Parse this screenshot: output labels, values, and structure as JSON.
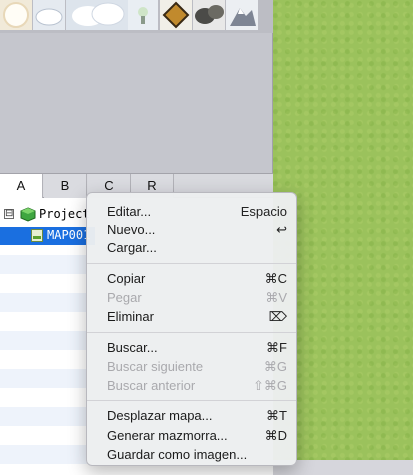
{
  "tabs": [
    {
      "label": "A",
      "active": true
    },
    {
      "label": "B",
      "active": false
    },
    {
      "label": "C",
      "active": false
    },
    {
      "label": "R",
      "active": false
    }
  ],
  "tileset": [
    {
      "icon": "cloud-glow-tile-icon"
    },
    {
      "icon": "snow-mound-tile-icon"
    },
    {
      "icon": "cloud-large-tile-icon"
    },
    {
      "icon": "cloud-puff-tile-icon"
    },
    {
      "icon": "small-tree-tile-icon"
    },
    {
      "icon": "golden-ornament-tile-icon"
    },
    {
      "icon": "dark-rocks-tile-icon"
    },
    {
      "icon": "snowy-rock-tile-icon"
    }
  ],
  "tree": {
    "project_label": "Project",
    "expander": "⊟",
    "map_label": "MAP001"
  },
  "menu": {
    "groups": [
      {
        "items": [
          {
            "label": "Editar...",
            "shortcut": "Espacio",
            "enabled": true
          },
          {
            "label": "Nuevo...",
            "shortcut": "↩",
            "enabled": true
          },
          {
            "label": "Cargar...",
            "shortcut": "",
            "enabled": true
          }
        ]
      },
      {
        "items": [
          {
            "label": "Copiar",
            "shortcut": "⌘C",
            "enabled": true
          },
          {
            "label": "Pegar",
            "shortcut": "⌘V",
            "enabled": false
          },
          {
            "label": "Eliminar",
            "shortcut": "⌦",
            "enabled": true
          }
        ]
      },
      {
        "items": [
          {
            "label": "Buscar...",
            "shortcut": "⌘F",
            "enabled": true
          },
          {
            "label": "Buscar siguiente",
            "shortcut": "⌘G",
            "enabled": false
          },
          {
            "label": "Buscar anterior",
            "shortcut": "⇧⌘G",
            "enabled": false
          }
        ]
      },
      {
        "items": [
          {
            "label": "Desplazar mapa...",
            "shortcut": "⌘T",
            "enabled": true
          },
          {
            "label": "Generar mazmorra...",
            "shortcut": "⌘D",
            "enabled": true
          },
          {
            "label": "Guardar como imagen...",
            "shortcut": "",
            "enabled": true
          }
        ]
      }
    ]
  },
  "colors": {
    "selection": "#1a6fe0",
    "map_grass": "#9bc25c",
    "panel": "#c5c6cd"
  }
}
